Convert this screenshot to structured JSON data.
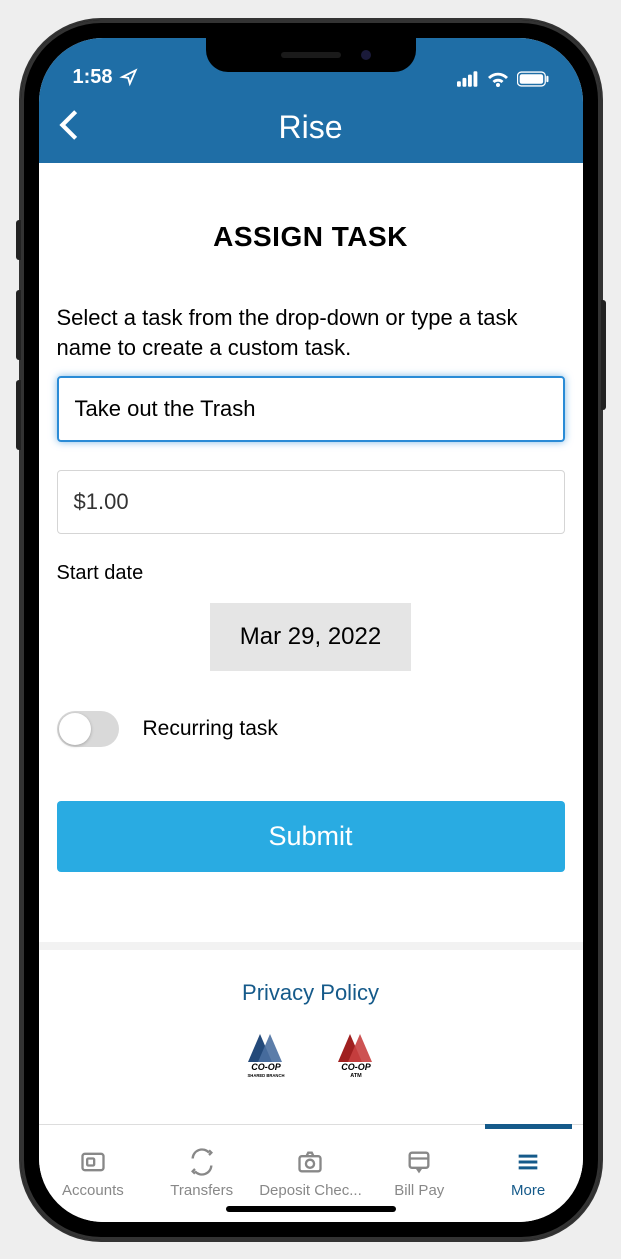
{
  "statusbar": {
    "time": "1:58"
  },
  "header": {
    "title": "Rise"
  },
  "page": {
    "title": "ASSIGN TASK",
    "instruction": "Select a task from the drop-down or type a task name to create a custom task.",
    "task_value": "Take out the Trash",
    "amount_value": "$1.00",
    "start_date_label": "Start date",
    "start_date_value": "Mar 29, 2022",
    "recurring_label": "Recurring task",
    "submit_label": "Submit"
  },
  "footer": {
    "privacy_label": "Privacy Policy",
    "logo1_text": "CO-OP",
    "logo1_sub": "SHARED BRANCH",
    "logo2_text": "CO-OP",
    "logo2_sub": "ATM"
  },
  "tabs": {
    "accounts": "Accounts",
    "transfers": "Transfers",
    "deposit": "Deposit Chec...",
    "billpay": "Bill Pay",
    "more": "More"
  }
}
